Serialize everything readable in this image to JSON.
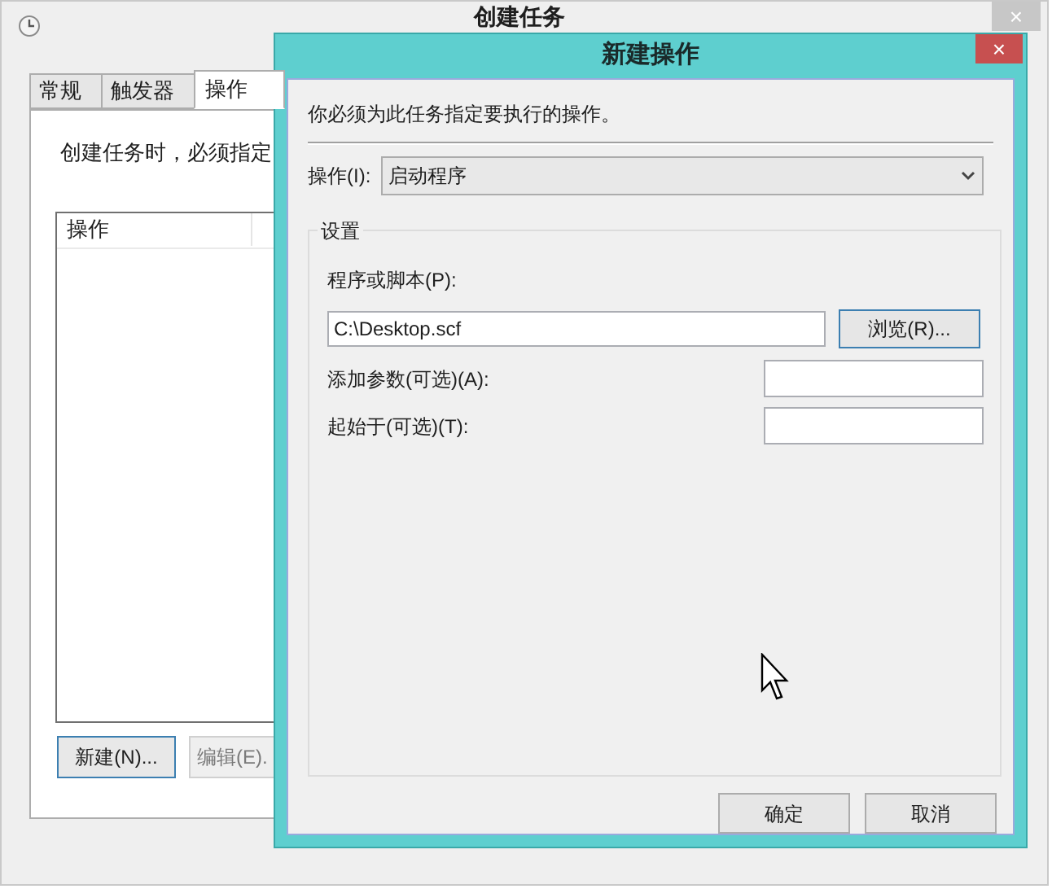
{
  "main_window": {
    "title": "创建任务",
    "close": "×",
    "tabs": [
      {
        "label": "常规",
        "selected": false
      },
      {
        "label": "触发器",
        "selected": false
      },
      {
        "label": "操作",
        "selected": true
      }
    ],
    "description": "创建任务时，必须指定",
    "table": {
      "columns": [
        "操作"
      ]
    },
    "buttons": [
      {
        "label": "新建(N)...",
        "focused": true
      },
      {
        "label": "编辑(E).",
        "focused": false
      }
    ]
  },
  "dialog": {
    "title": "新建操作",
    "close": "×",
    "instruction": "你必须为此任务指定要执行的操作。",
    "action": {
      "label": "操作(I):",
      "value": "启动程序"
    },
    "settings": {
      "title": "设置",
      "program_label": "程序或脚本(P):",
      "program_value": "C:\\Desktop.scf",
      "browse": "浏览(R)...",
      "fields": [
        {
          "label": "添加参数(可选)(A):"
        },
        {
          "label": "起始于(可选)(T):"
        }
      ]
    },
    "buttons": [
      {
        "label": "确定"
      },
      {
        "label": "取消"
      }
    ]
  }
}
